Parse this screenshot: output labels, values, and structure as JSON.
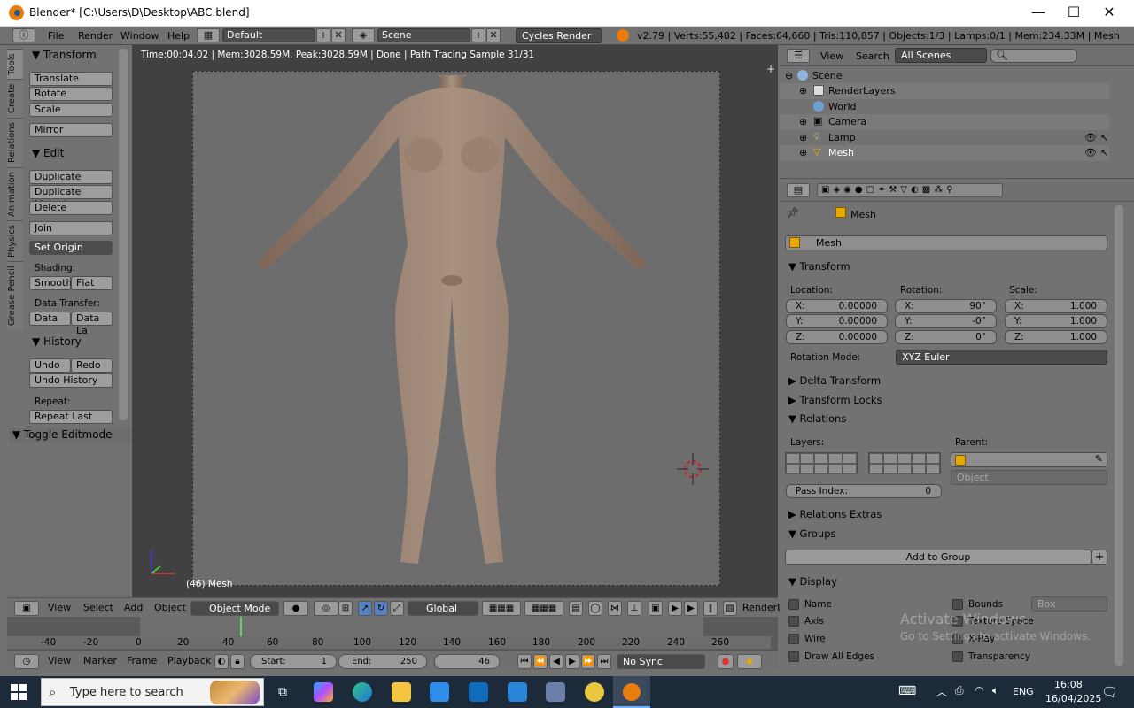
{
  "window": {
    "title": "Blender* [C:\\Users\\D\\Desktop\\ABC.blend]",
    "minimize": "—",
    "maximize": "☐",
    "close": "✕"
  },
  "infobar": {
    "menus": [
      "File",
      "Render",
      "Window",
      "Help"
    ],
    "layout": "Default",
    "scene": "Scene",
    "engine": "Cycles Render",
    "stats": "v2.79 | Verts:55,482 | Faces:64,660 | Tris:110,857 | Objects:1/3 | Lamps:0/1 | Mem:234.33M | Mesh"
  },
  "tool_tabs": [
    "Tools",
    "Create",
    "Relations",
    "Animation",
    "Physics",
    "Grease Pencil"
  ],
  "toolshelf": {
    "transform_header": "Transform",
    "translate": "Translate",
    "rotate": "Rotate",
    "scale": "Scale",
    "mirror": "Mirror",
    "edit_header": "Edit",
    "duplicate": "Duplicate",
    "duplicate_linked": "Duplicate Linked",
    "delete": "Delete",
    "join": "Join",
    "set_origin": "Set Origin",
    "shading_label": "Shading:",
    "smooth": "Smooth",
    "flat": "Flat",
    "data_transfer_label": "Data Transfer:",
    "data": "Data",
    "data_layout": "Data La",
    "history_header": "History",
    "undo": "Undo",
    "redo": "Redo",
    "undo_history": "Undo History",
    "repeat_label": "Repeat:",
    "repeat_last": "Repeat Last",
    "toggle_editmode": "Toggle Editmode"
  },
  "viewport": {
    "hud": "Time:00:04.02 | Mem:3028.59M, Peak:3028.59M | Done | Path Tracing Sample 31/31",
    "object_label": "(46) Mesh"
  },
  "view3d_header": {
    "menus": [
      "View",
      "Select",
      "Add",
      "Object"
    ],
    "mode": "Object Mode",
    "orientation": "Global",
    "render_layer": "RenderL"
  },
  "timeline": {
    "ticks": [
      "-40",
      "-20",
      "0",
      "20",
      "40",
      "60",
      "80",
      "100",
      "120",
      "140",
      "160",
      "180",
      "200",
      "220",
      "240",
      "260"
    ],
    "menus": [
      "View",
      "Marker",
      "Frame",
      "Playback"
    ],
    "start_label": "Start:",
    "start_value": "1",
    "end_label": "End:",
    "end_value": "250",
    "current_frame": "46",
    "sync": "No Sync"
  },
  "outliner": {
    "menus": [
      "View",
      "Search"
    ],
    "filter": "All Scenes",
    "rows": [
      "Scene",
      "RenderLayers",
      "World",
      "Camera",
      "Lamp",
      "Mesh"
    ]
  },
  "properties": {
    "breadcrumb": "Mesh",
    "object_name": "Mesh",
    "transform_header": "Transform",
    "location_label": "Location:",
    "rotation_label": "Rotation:",
    "scale_label": "Scale:",
    "loc": {
      "x": "0.00000",
      "y": "0.00000",
      "z": "0.00000"
    },
    "rot": {
      "x": "90°",
      "y": "-0°",
      "z": "0°"
    },
    "scl": {
      "x": "1.000",
      "y": "1.000",
      "z": "1.000"
    },
    "axis_x": "X:",
    "axis_y": "Y:",
    "axis_z": "Z:",
    "rotation_mode_label": "Rotation Mode:",
    "rotation_mode": "XYZ Euler",
    "delta_transform": "Delta Transform",
    "transform_locks": "Transform Locks",
    "relations": "Relations",
    "layers_label": "Layers:",
    "parent_label": "Parent:",
    "parent_type": "Object",
    "pass_index_label": "Pass Index:",
    "pass_index": "0",
    "relations_extras": "Relations Extras",
    "groups": "Groups",
    "add_to_group": "Add to Group",
    "display": "Display",
    "display_name": "Name",
    "display_axis": "Axis",
    "display_wire": "Wire",
    "display_draw_all_edges": "Draw All Edges",
    "display_bounds": "Bounds",
    "display_bounds_type": "Box",
    "display_texture_space": "Texture Space",
    "display_xray": "X-Ray",
    "display_transparency": "Transparency"
  },
  "watermark": {
    "line1": "Activate Windows",
    "line2": "Go to Settings to activate Windows."
  },
  "taskbar": {
    "search_placeholder": "Type here to search",
    "lang": "ENG",
    "time": "16:08",
    "date": "16/04/2025"
  }
}
